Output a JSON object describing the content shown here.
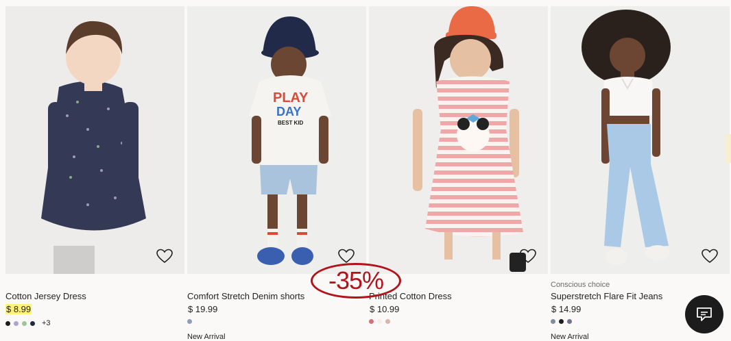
{
  "products": [
    {
      "name": "Cotton Jersey Dress",
      "price": "$ 8.99",
      "tag": "",
      "badge": "",
      "more": "+3",
      "swatches": [
        "#1c1c1c",
        "#a9a6c8",
        "#9fc49a",
        "#222a3a"
      ],
      "highlight": true
    },
    {
      "name": "Comfort Stretch Denim shorts",
      "price": "$ 19.99",
      "tag": "",
      "badge": "New Arrival",
      "more": "",
      "swatches": [
        "#8e9dbd"
      ],
      "highlight": false
    },
    {
      "name": "Printed Cotton Dress",
      "price": "$ 10.99",
      "tag": "",
      "badge": "",
      "more": "",
      "swatches": [
        "#d4707a",
        "#f4eee6",
        "#d9b5ab"
      ],
      "highlight": false
    },
    {
      "name": "Superstretch Flare Fit Jeans",
      "price": "$ 14.99",
      "tag": "Conscious choice",
      "badge": "New Arrival",
      "more": "",
      "swatches": [
        "#7f8aa3",
        "#1e1e1e",
        "#6d7390"
      ],
      "highlight": false
    }
  ],
  "discount_label": "-35%",
  "icons": {
    "favorite": "heart-icon",
    "chat": "chat-icon"
  }
}
